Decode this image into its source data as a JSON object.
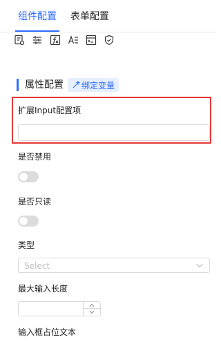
{
  "tabs": [
    {
      "label": "组件配置",
      "active": true
    },
    {
      "label": "表单配置",
      "active": false
    }
  ],
  "toolbar_icons": [
    "document-settings-icon",
    "sliders-icon",
    "function-icon",
    "text-style-icon",
    "form-layout-icon",
    "shield-check-icon"
  ],
  "section": {
    "title": "属性配置",
    "bind_label": "绑定变量"
  },
  "fields": {
    "ext_input": {
      "label": "扩展Input配置项",
      "value": ""
    },
    "disabled": {
      "label": "是否禁用",
      "on": false
    },
    "readonly": {
      "label": "是否只读",
      "on": false
    },
    "type": {
      "label": "类型",
      "placeholder": "Select"
    },
    "max_length": {
      "label": "最大输入长度",
      "value": ""
    },
    "placeholder_text": {
      "label": "输入框占位文本"
    }
  },
  "colors": {
    "accent": "#2f6bff",
    "highlight_border": "#e53935",
    "tag_bg": "#e6efff"
  }
}
